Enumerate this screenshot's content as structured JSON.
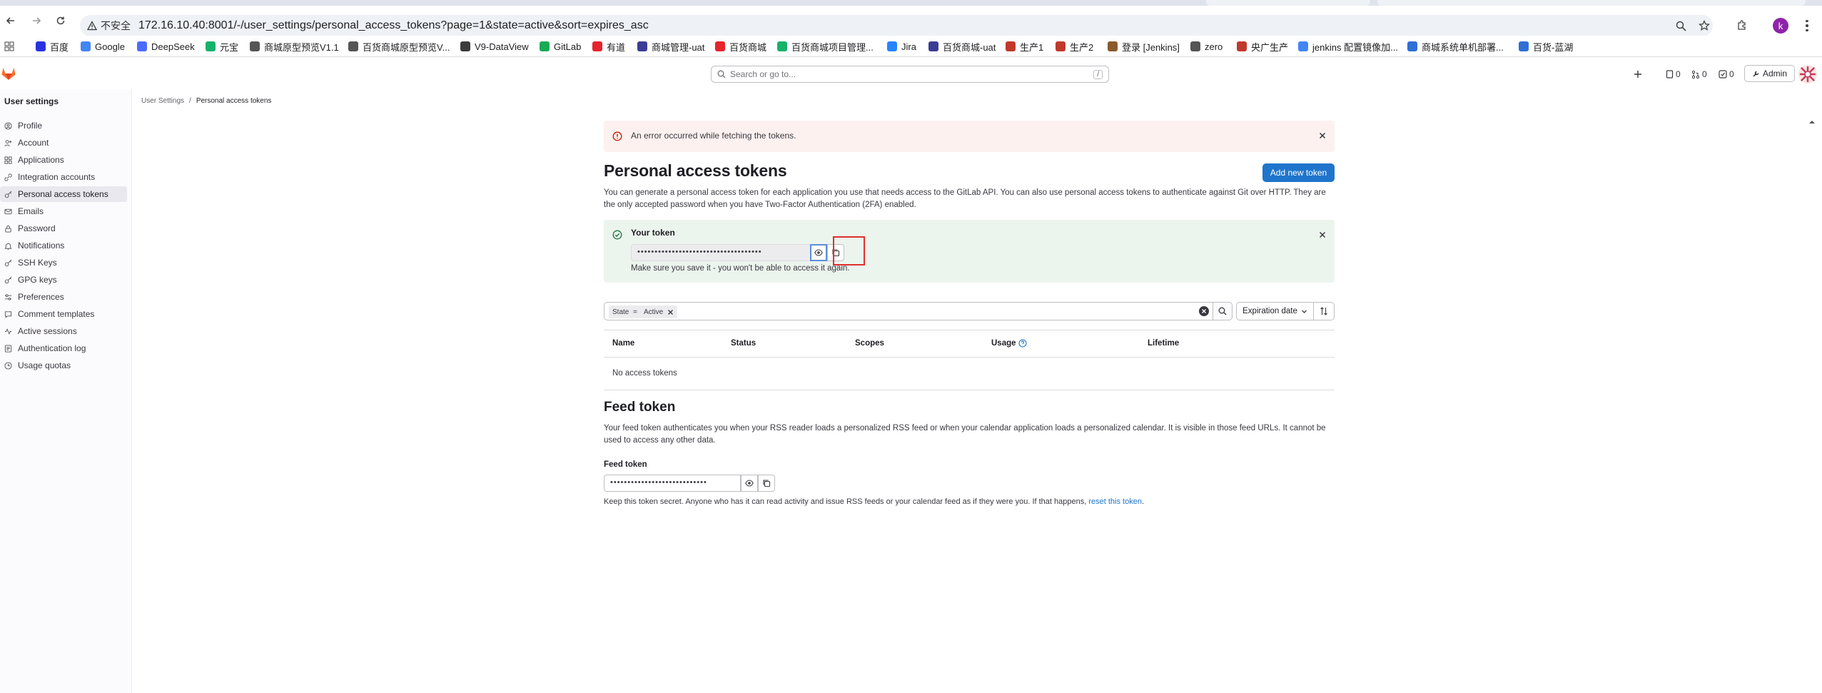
{
  "browser": {
    "security_label": "不安全",
    "url": "172.16.10.40:8001/-/user_settings/personal_access_tokens?page=1&state=active&sort=expires_asc",
    "profile_initial": "k",
    "bookmarks": [
      {
        "label": "百度",
        "color": "#2932e1"
      },
      {
        "label": "Google",
        "color": "#4285f4"
      },
      {
        "label": "DeepSeek",
        "color": "#4d6bfe"
      },
      {
        "label": "元宝",
        "color": "#17b26a"
      },
      {
        "label": "商城原型预览V1.1",
        "color": "#555555"
      },
      {
        "label": "百货商城原型预览V...",
        "color": "#555555"
      },
      {
        "label": "V9-DataView",
        "color": "#3b3b3b"
      },
      {
        "label": "GitLab",
        "color": "#1aaa55"
      },
      {
        "label": "有道",
        "color": "#e5242b"
      },
      {
        "label": "商城管理-uat",
        "color": "#3c3c96"
      },
      {
        "label": "百货商城",
        "color": "#e5242b"
      },
      {
        "label": "百货商城项目管理...",
        "color": "#17b26a"
      },
      {
        "label": "Jira",
        "color": "#2684ff"
      },
      {
        "label": "百货商城-uat",
        "color": "#3c3c96"
      },
      {
        "label": "生产1",
        "color": "#c0392b"
      },
      {
        "label": "生产2",
        "color": "#c0392b"
      },
      {
        "label": "登录 [Jenkins]",
        "color": "#8b5a2b"
      },
      {
        "label": "zero",
        "color": "#555555"
      },
      {
        "label": "央广生产",
        "color": "#c0392b"
      },
      {
        "label": "jenkins 配置镜像加...",
        "color": "#4285f4"
      },
      {
        "label": "商城系统单机部署...",
        "color": "#2f6fd6"
      },
      {
        "label": "百货-蓝湖",
        "color": "#2f6fd6"
      }
    ]
  },
  "gitlab": {
    "search_placeholder": "Search or go to...",
    "search_shortcut": "/",
    "counts": {
      "issues": "0",
      "merge_requests": "0",
      "todos": "0"
    },
    "admin_label": "Admin"
  },
  "sidebar": {
    "title": "User settings",
    "items": [
      {
        "label": "Profile",
        "icon": "profile-icon"
      },
      {
        "label": "Account",
        "icon": "account-icon"
      },
      {
        "label": "Applications",
        "icon": "applications-icon"
      },
      {
        "label": "Integration accounts",
        "icon": "integration-icon"
      },
      {
        "label": "Personal access tokens",
        "icon": "token-icon",
        "active": true
      },
      {
        "label": "Emails",
        "icon": "mail-icon"
      },
      {
        "label": "Password",
        "icon": "lock-icon"
      },
      {
        "label": "Notifications",
        "icon": "bell-icon"
      },
      {
        "label": "SSH Keys",
        "icon": "key-icon"
      },
      {
        "label": "GPG keys",
        "icon": "key-icon"
      },
      {
        "label": "Preferences",
        "icon": "preferences-icon"
      },
      {
        "label": "Comment templates",
        "icon": "comment-icon"
      },
      {
        "label": "Active sessions",
        "icon": "sessions-icon"
      },
      {
        "label": "Authentication log",
        "icon": "log-icon"
      },
      {
        "label": "Usage quotas",
        "icon": "quota-icon"
      }
    ]
  },
  "breadcrumb": {
    "parent": "User Settings",
    "separator": "/",
    "current": "Personal access tokens"
  },
  "error_alert": {
    "text": "An error occurred while fetching the tokens."
  },
  "page": {
    "title": "Personal access tokens",
    "add_button": "Add new token",
    "intro": "You can generate a personal access token for each application you use that needs access to the GitLab API. You can also use personal access tokens to authenticate against Git over HTTP. They are the only accepted password when you have Two-Factor Authentication (2FA) enabled."
  },
  "token_alert": {
    "label": "Your token",
    "masked_value": "••••••••••••••••••••••••••••••••••••",
    "hint": "Make sure you save it - you won't be able to access it again."
  },
  "filter": {
    "token_key": "State",
    "token_op": "=",
    "token_value": "Active",
    "sort_label": "Expiration date"
  },
  "table": {
    "headers": [
      "Name",
      "Status",
      "Scopes",
      "Usage",
      "Lifetime"
    ],
    "empty": "No access tokens"
  },
  "feed": {
    "title": "Feed token",
    "description": "Your feed token authenticates you when your RSS reader loads a personalized RSS feed or when your calendar application loads a personalized calendar. It is visible in those feed URLs. It cannot be used to access any other data.",
    "label": "Feed token",
    "masked_value": "••••••••••••••••••••••••••••",
    "note_before": "Keep this token secret. Anyone who has it can read activity and issue RSS feeds or your calendar feed as if they were you. If that happens, ",
    "note_link": "reset this token",
    "note_after": "."
  },
  "colors": {
    "primary": "#1f75cb",
    "error_bg": "#fcf1ef",
    "success_bg": "#ecf4ee",
    "highlight": "#e0302c"
  }
}
